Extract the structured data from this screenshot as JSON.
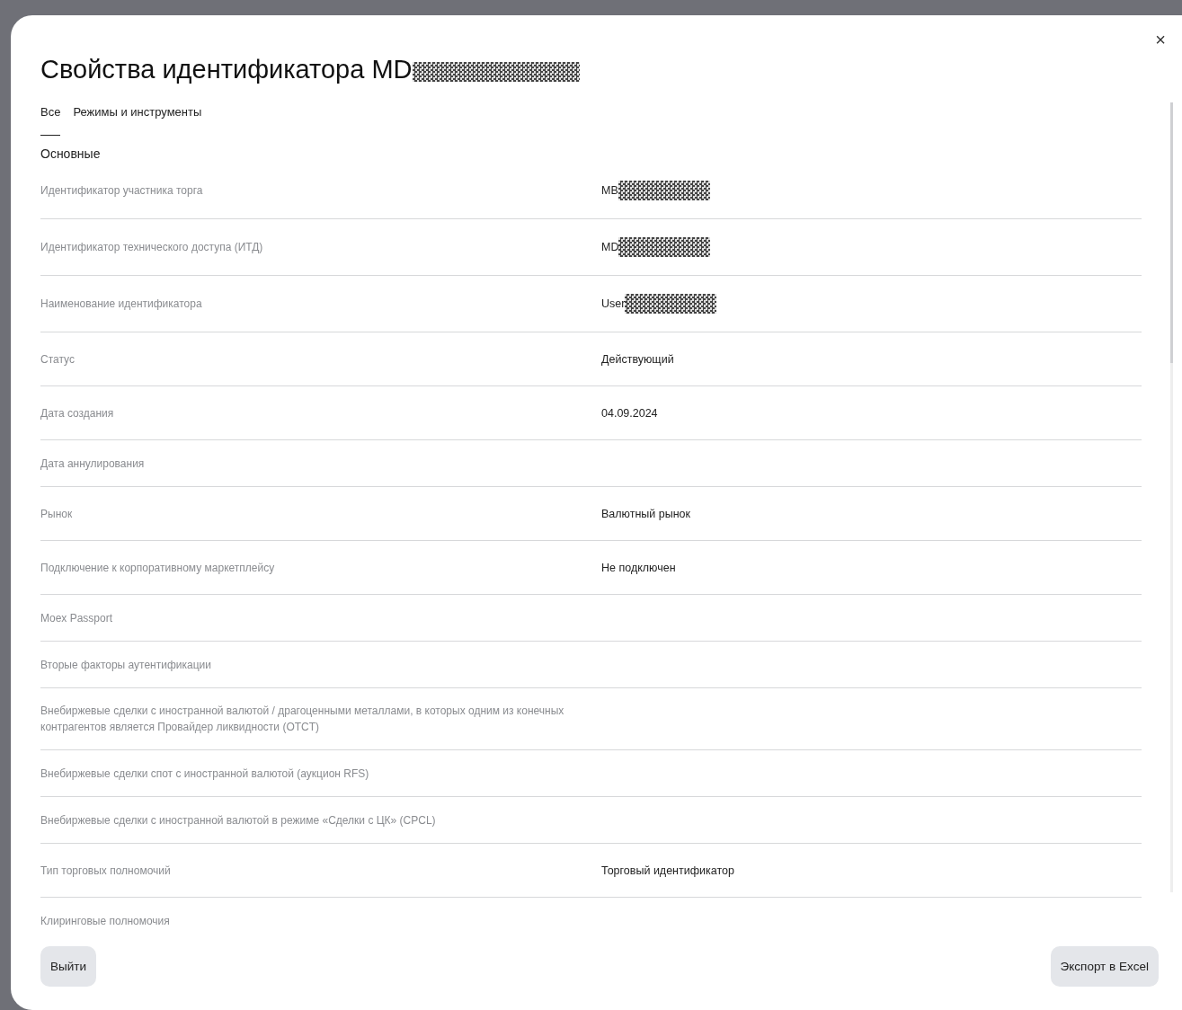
{
  "dialog": {
    "title": "Свойства идентификатора MD",
    "title_redacted": true,
    "close": "×"
  },
  "tabs": [
    {
      "label": "Все",
      "selected": true
    },
    {
      "label": "Режимы и инструменты",
      "selected": false
    }
  ],
  "section": "Основные",
  "rows": [
    {
      "label": "Идентификатор участника торга",
      "value": "MB",
      "redacted": true
    },
    {
      "label": "Идентификатор технического доступа (ИТД)",
      "value": "MD",
      "redacted": true
    },
    {
      "label": "Наименование идентификатора",
      "value": "User",
      "redacted": true
    },
    {
      "label": "Статус",
      "value": "Действующий"
    },
    {
      "label": "Дата создания",
      "value": "04.09.2024"
    },
    {
      "label": "Дата аннулирования"
    },
    {
      "label": "Рынок",
      "value": "Валютный рынок"
    },
    {
      "label": "Подключение к корпоративному маркетплейсу",
      "value": "Не подключен"
    },
    {
      "label": "Moex Passport"
    },
    {
      "label": "Вторые факторы аутентификации"
    },
    {
      "label": "Внебиржевые сделки с иностранной валютой / драгоценными металлами, в которых одним из конечных контрагентов является Провайдер ликвидности (OTCT)"
    },
    {
      "label": "Внебиржевые сделки спот с иностранной валютой (аукцион RFS)"
    },
    {
      "label": "Внебиржевые сделки с иностранной валютой в режиме «Сделки с ЦК» (CPCL)"
    },
    {
      "label": "Тип торговых полномочий",
      "value": "Торговый идентификатор"
    },
    {
      "label": "Клиринговые полномочия"
    }
  ],
  "buttons": {
    "exit": "Выйти",
    "export": "Экспорт в Excel"
  }
}
